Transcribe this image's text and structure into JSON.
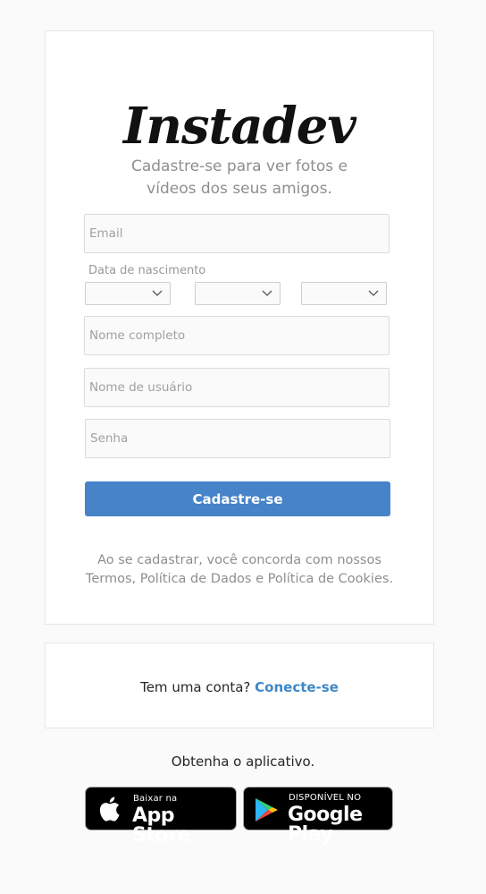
{
  "brand": {
    "logo_text": "Instadev"
  },
  "signup": {
    "subtitle": "Cadastre-se para ver fotos e vídeos dos seus amigos.",
    "email_placeholder": "Email",
    "dob_label": "Data de nascimento",
    "dob_day_value": "",
    "dob_month_value": "",
    "dob_year_value": "",
    "fullname_placeholder": "Nome completo",
    "username_placeholder": "Nome de usuário",
    "password_placeholder": "Senha",
    "submit_label": "Cadastre-se",
    "terms_text": "Ao se cadastrar, você concorda com nossos Termos, Política de Dados e Política de Cookies."
  },
  "login": {
    "prompt": "Tem uma conta?",
    "link_label": "Conecte-se"
  },
  "get_app": {
    "label": "Obtenha o aplicativo.",
    "app_store_small": "Baixar na",
    "app_store_big": "App Store",
    "google_play_small": "DISPONÍVEL NO",
    "google_play_big": "Google Play"
  },
  "colors": {
    "primary_button": "#4683c8",
    "link": "#3d88c8",
    "background": "#fafafa"
  },
  "icons": {
    "dropdown": "chevron-down-icon",
    "apple": "apple-icon",
    "google_play": "google-play-icon"
  }
}
